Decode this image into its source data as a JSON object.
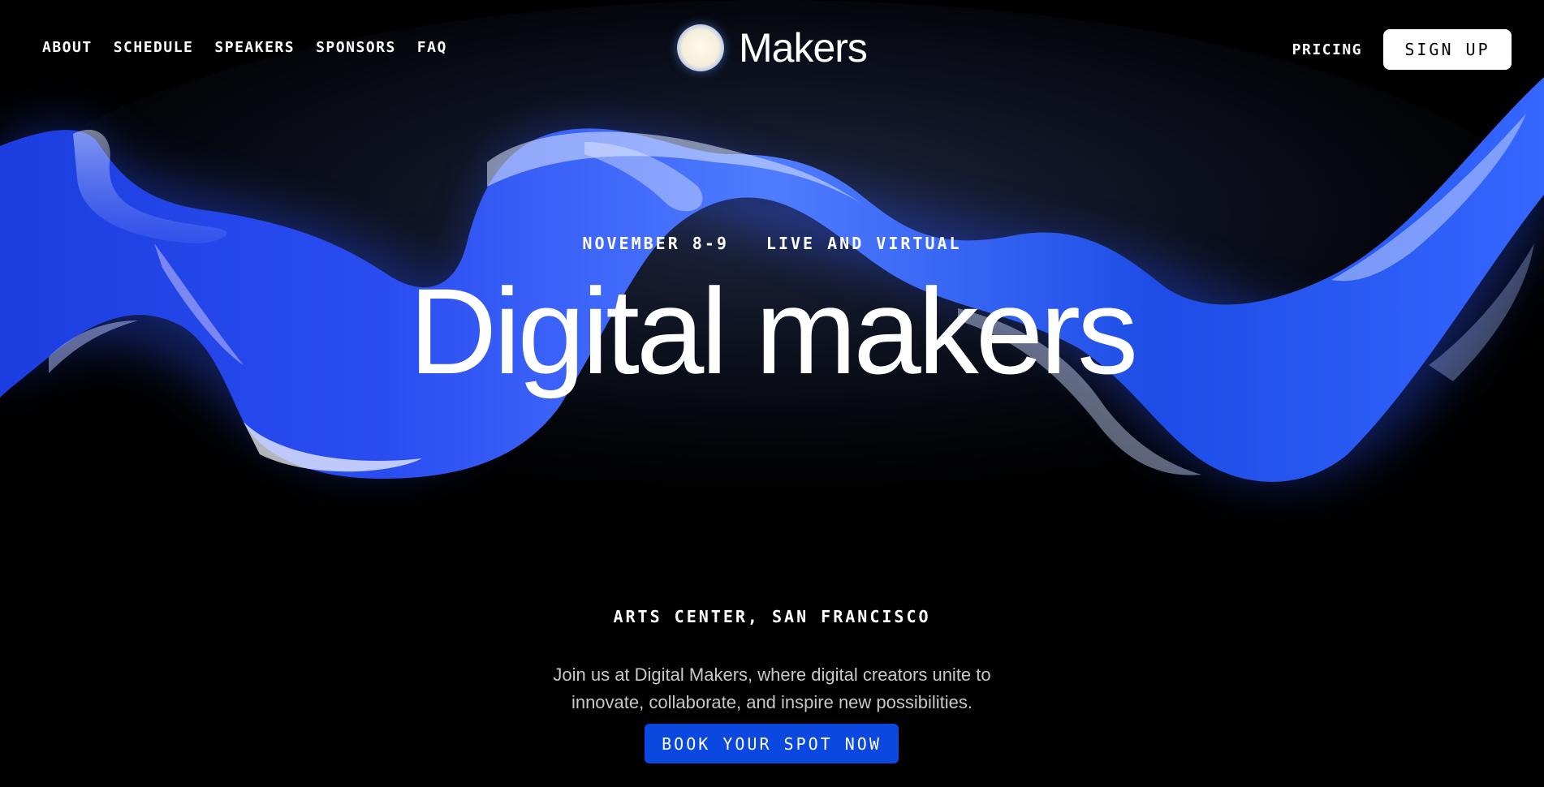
{
  "nav": {
    "links": [
      "ABOUT",
      "SCHEDULE",
      "SPEAKERS",
      "SPONSORS",
      "FAQ"
    ],
    "pricing": "PRICING",
    "signup": "SIGN UP"
  },
  "brand": {
    "name": "Makers"
  },
  "hero": {
    "date": "NOVEMBER 8-9",
    "format": "LIVE AND VIRTUAL",
    "headline": "Digital makers",
    "location": "ARTS CENTER, SAN FRANCISCO",
    "description": "Join us at Digital Makers, where digital creators unite to innovate, collaborate, and inspire new possibilities.",
    "cta": "BOOK YOUR SPOT NOW"
  },
  "colors": {
    "background": "#000000",
    "ribbon": "#1f4bff",
    "cta": "#0a48e0",
    "text": "#ffffff"
  },
  "icons": [
    "glow-orb-logo-icon",
    "glass-ribbon-graphic"
  ]
}
